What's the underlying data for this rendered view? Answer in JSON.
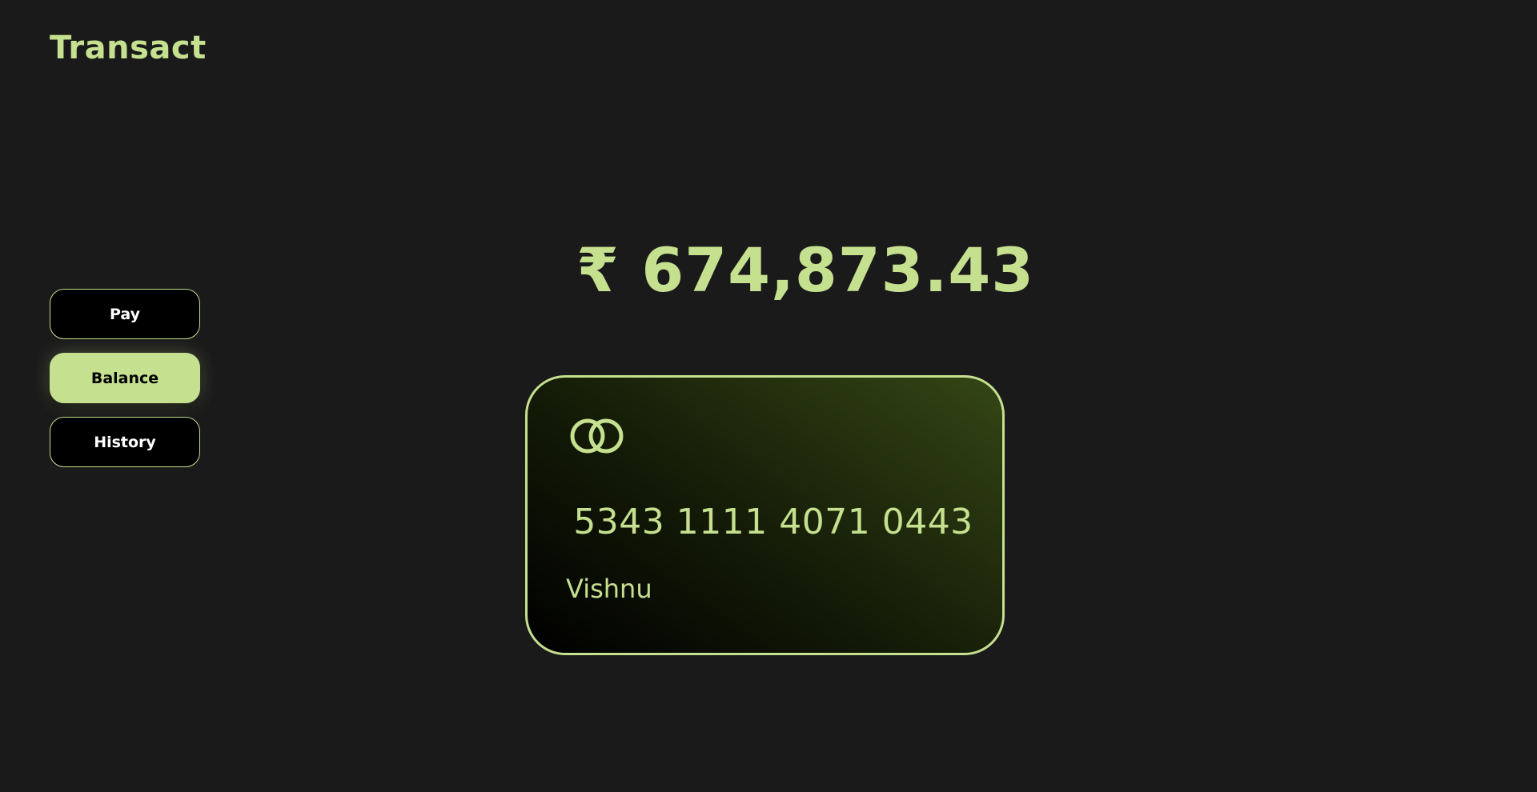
{
  "app": {
    "title": "Transact"
  },
  "nav": {
    "items": [
      {
        "label": "Pay",
        "active": false
      },
      {
        "label": "Balance",
        "active": true
      },
      {
        "label": "History",
        "active": false
      }
    ]
  },
  "balance": {
    "amount": "₹ 674,873.43"
  },
  "card": {
    "logo_icon": "card-network-rings-icon",
    "number": "5343 1111 4071 0443",
    "holder": "Vishnu"
  },
  "colors": {
    "background": "#1a1a1a",
    "accent": "#c5e08f",
    "button_bg": "#000000"
  }
}
